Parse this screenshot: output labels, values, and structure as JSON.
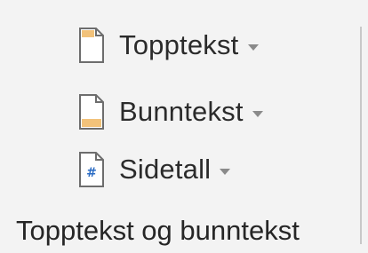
{
  "ribbon_group": {
    "commands": {
      "header": {
        "label": "Topptekst",
        "icon": "page-header-icon"
      },
      "footer": {
        "label": "Bunntekst",
        "icon": "page-footer-icon"
      },
      "page_number": {
        "label": "Sidetall",
        "icon": "page-number-icon"
      }
    },
    "group_label": "Topptekst og bunntekst"
  },
  "colors": {
    "background": "#f3f3f3",
    "text": "#262626",
    "accent_fill": "#f2c27a",
    "number_blue": "#2b6cc4"
  }
}
